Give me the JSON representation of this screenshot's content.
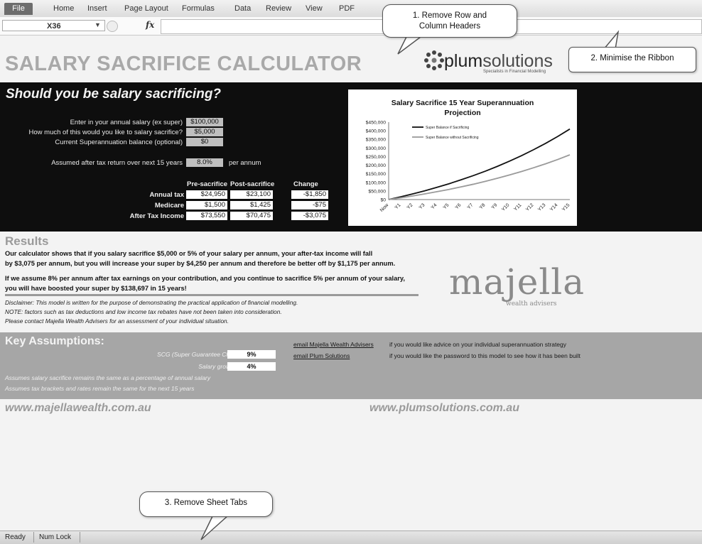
{
  "ribbon": {
    "tabs": [
      "File",
      "Home",
      "Insert",
      "Page Layout",
      "Formulas",
      "Data",
      "Review",
      "View",
      "PDF"
    ]
  },
  "formula_bar": {
    "name_box": "X36",
    "fx_label": "fx",
    "formula": ""
  },
  "title": "SALARY SACRIFICE CALCULATOR",
  "plum_logo": {
    "name_bold": "plum",
    "name_rest": "solutions",
    "tagline": "Specialists in Financial Modelling"
  },
  "calculator": {
    "heading": "Should you be salary sacrificing?",
    "inputs": [
      {
        "label": "Enter in your annual salary (ex super)",
        "value": "$100,000"
      },
      {
        "label": "How much of this would you like to salary sacrifice?",
        "value": "$5,000"
      },
      {
        "label": "Current Superannuation balance (optional)",
        "value": "$0"
      }
    ],
    "return_label": "Assumed after tax return over next 15 years",
    "return_value": "8.0%",
    "return_suffix": "per annum",
    "table": {
      "headers": [
        "Pre-sacrifice",
        "Post-sacrifice",
        "Change"
      ],
      "rows": [
        {
          "label": "Annual tax",
          "pre": "$24,950",
          "post": "$23,100",
          "change": "-$1,850"
        },
        {
          "label": "Medicare",
          "pre": "$1,500",
          "post": "$1,425",
          "change": "-$75"
        },
        {
          "label": "After Tax Income",
          "pre": "$73,550",
          "post": "$70,475",
          "change": "-$3,075"
        }
      ]
    }
  },
  "chart_data": {
    "type": "line",
    "title": "Salary Sacrifice 15 Year Superannuation Projection",
    "title_lines": [
      "Salary Sacrifice 15 Year Superannuation",
      "Projection"
    ],
    "categories": [
      "Now",
      "Y1",
      "Y2",
      "Y3",
      "Y4",
      "Y5",
      "Y6",
      "Y7",
      "Y8",
      "Y9",
      "Y10",
      "Y11",
      "Y12",
      "Y13",
      "Y14",
      "Y15"
    ],
    "y_ticks": [
      "$0",
      "$50,000",
      "$100,000",
      "$150,000",
      "$200,000",
      "$250,000",
      "$300,000",
      "$350,000",
      "$400,000",
      "$450,000"
    ],
    "ylim": [
      0,
      450000
    ],
    "legend_placement": "top-left",
    "grid": false,
    "series": [
      {
        "name": "Super Balance if Sacrificing",
        "color": "#111111",
        "values": [
          0,
          16000,
          33000,
          51000,
          71000,
          92000,
          115000,
          139000,
          165000,
          193000,
          223000,
          255000,
          290000,
          327000,
          367000,
          410000
        ]
      },
      {
        "name": "Super Balance without Sacrificing",
        "color": "#9a9a9a",
        "values": [
          0,
          10000,
          21000,
          33000,
          46000,
          59000,
          74000,
          89000,
          106000,
          124000,
          143000,
          163000,
          185000,
          208000,
          233000,
          260000
        ]
      }
    ]
  },
  "results": {
    "title": "Results",
    "p1_line1": "Our calculator shows that if you salary sacrifice $5,000 or 5% of your salary per annum, your after-tax income will fall",
    "p1_line2": "by $3,075 per annum, but you will increase your super by $4,250 per annum and therefore be better off by $1,175 per annum.",
    "p2_line1": "If we assume 8% per annum after tax earnings on your contribution, and you continue to sacrifice 5% per annum of your salary,",
    "p2_line2": "you will have boosted your super by $138,697 in 15 years!",
    "disclaimer": [
      "Disclaimer: This model is written for the purpose of demonstrating the practical application of financial modelling.",
      "NOTE: factors such as tax deductions and low income tax rebates have not been taken into consideration.",
      "Please contact Majella Wealth Advisers for an assessment of your individual situation."
    ]
  },
  "majella_logo": {
    "name": "majella",
    "sub": "wealth advisers"
  },
  "key_assumptions": {
    "title": "Key Assumptions:",
    "items": [
      {
        "label": "SCG (Super Guarantee Charge)",
        "value": "9%"
      },
      {
        "label": "Salary growth pa",
        "value": "4%"
      }
    ],
    "notes": [
      "Assumes salary sacrifice remains the same as a percentage of annual salary",
      "Assumes tax brackets and rates remain the same for the next 15 years"
    ],
    "links": [
      {
        "link": "email Majella Wealth Advisers",
        "text": "if you would like advice on your individual superannuation strategy"
      },
      {
        "link": "email Plum Solutions",
        "text": "if you would like the password to this model to see how it has been built"
      }
    ]
  },
  "websites": [
    "www.majellawealth.com.au",
    "www.plumsolutions.com.au"
  ],
  "status_bar": [
    "Ready",
    "Num Lock"
  ],
  "callouts": {
    "c1": "1. Remove Row and Column Headers",
    "c2": "2. Minimise the Ribbon",
    "c3": "3. Remove Sheet Tabs"
  }
}
